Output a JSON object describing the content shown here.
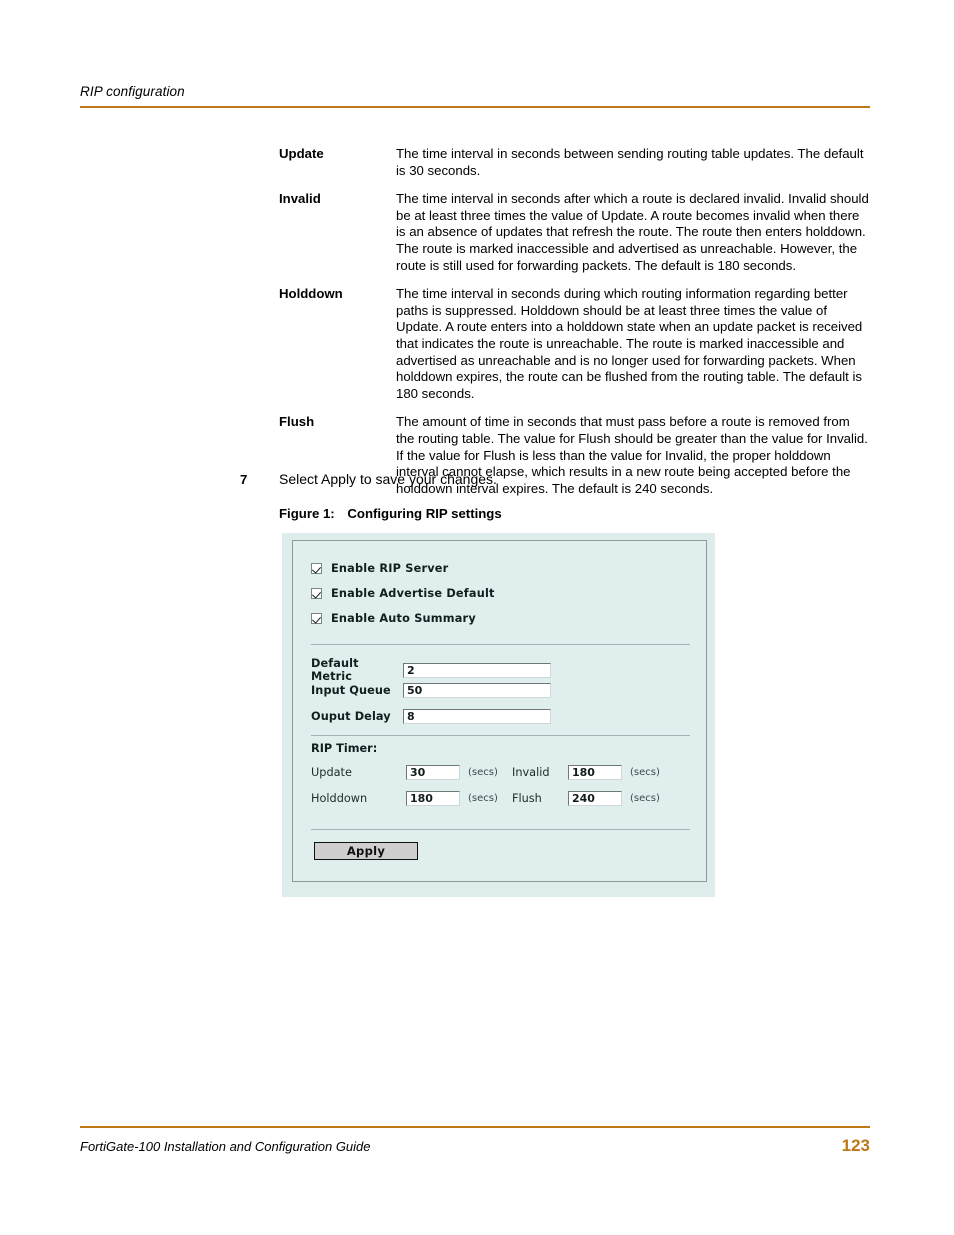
{
  "header": {
    "running_head": "RIP configuration",
    "rule_color": "#BF7717"
  },
  "definitions": [
    {
      "term": "Update",
      "description": "The time interval in seconds between sending routing table updates. The default is 30 seconds."
    },
    {
      "term": "Invalid",
      "description": "The time interval in seconds after which a route is declared invalid. Invalid should be at least three times the value of Update. A route becomes invalid when there is an absence of updates that refresh the route. The route then enters holddown. The route is marked inaccessible and advertised as unreachable. However, the route is still used for forwarding packets. The default is 180 seconds."
    },
    {
      "term": "Holddown",
      "description": "The time interval in seconds during which routing information regarding better paths is suppressed. Holddown should be at least three times the value of Update. A route enters into a holddown state when an update packet is received that indicates the route is unreachable. The route is marked inaccessible and advertised as unreachable and is no longer used for forwarding packets. When holddown expires, the route can be flushed from the routing table. The default is 180 seconds."
    },
    {
      "term": "Flush",
      "description": "The amount of time in seconds that must pass before a route is removed from the routing table. The value for Flush should be greater than the value for Invalid. If the value for Flush is less than the value for Invalid, the proper holddown interval cannot elapse, which results in a new route being accepted before the holddown interval expires. The default is 240 seconds."
    }
  ],
  "step": {
    "number": "7",
    "text": "Select Apply to save your changes."
  },
  "figure": {
    "caption_label": "Figure 1:",
    "caption_text": "Configuring RIP settings",
    "panel_bg": "#DEECEB",
    "checkboxes": [
      {
        "label": "Enable RIP Server",
        "checked": true
      },
      {
        "label": "Enable Advertise Default",
        "checked": true
      },
      {
        "label": "Enable Auto Summary",
        "checked": true
      }
    ],
    "fields": [
      {
        "label": "Default Metric",
        "value": "2"
      },
      {
        "label": "Input Queue",
        "value": "50"
      },
      {
        "label": "Ouput Delay",
        "value": "8"
      }
    ],
    "timer_section_title": "RIP Timer:",
    "timers": [
      {
        "left_label": "Update",
        "left_value": "30",
        "left_units": "(secs)",
        "right_label": "Invalid",
        "right_value": "180",
        "right_units": "(secs)"
      },
      {
        "left_label": "Holddown",
        "left_value": "180",
        "left_units": "(secs)",
        "right_label": "Flush",
        "right_value": "240",
        "right_units": "(secs)"
      }
    ],
    "apply_label": "Apply"
  },
  "footer": {
    "guide_title": "FortiGate-100 Installation and Configuration Guide",
    "page_number": "123",
    "accent_color": "#BF7717"
  }
}
